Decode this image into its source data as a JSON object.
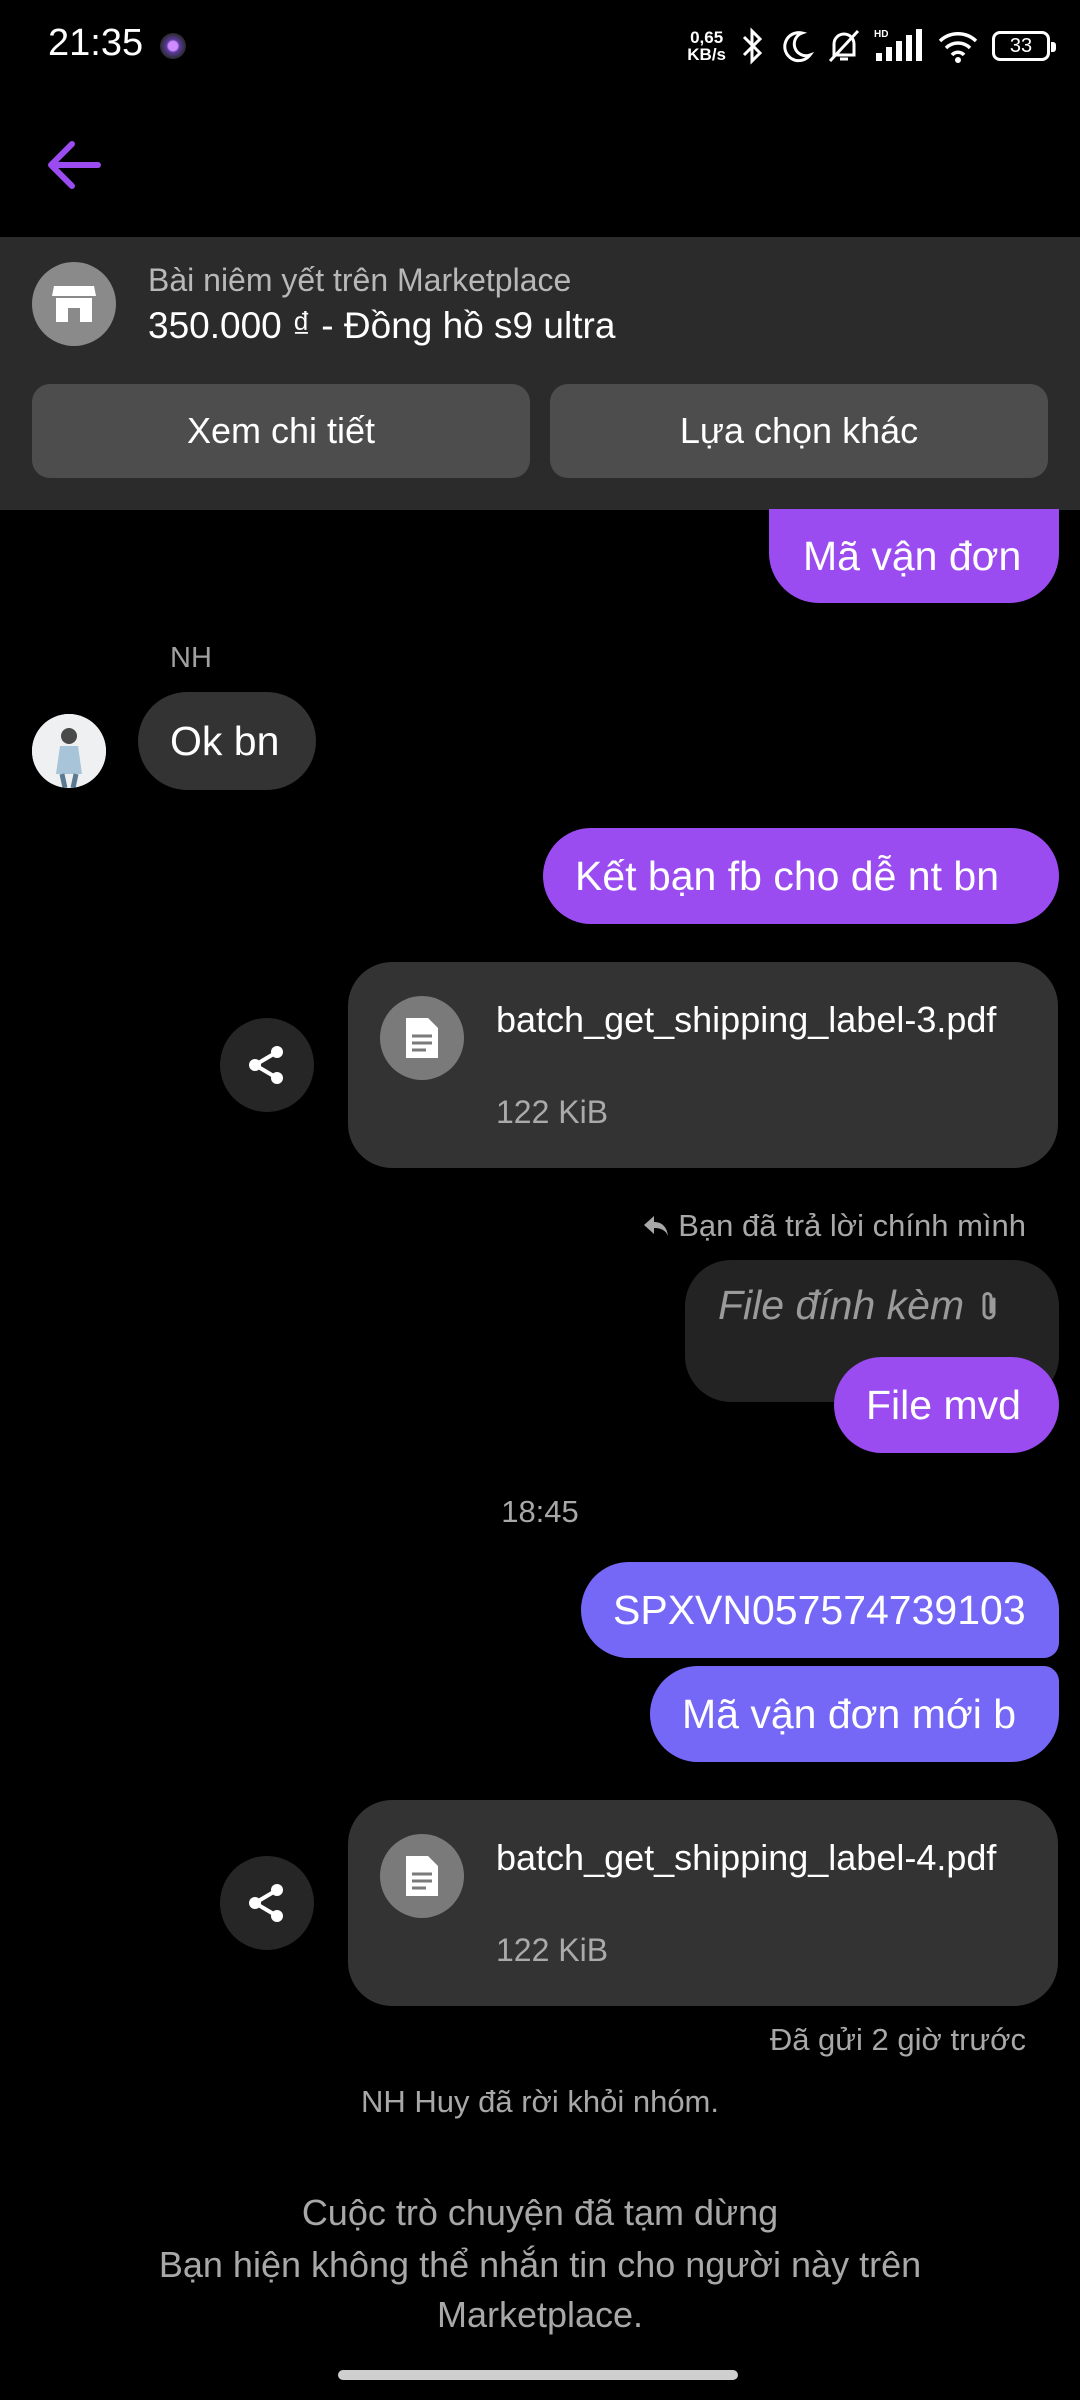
{
  "status_bar": {
    "time": "21:35",
    "net_speed_value": "0,65",
    "net_speed_unit": "KB/s",
    "battery": "33"
  },
  "marketplace": {
    "subtitle": "Bài niêm yết trên Marketplace",
    "title": "350.000 ₫ - Đồng hồ s9 ultra",
    "view_details": "Xem chi tiết",
    "other_options": "Lựa chọn khác"
  },
  "messages": {
    "m1": "Mã vận đơn",
    "sender_name": "NH",
    "m2": "Ok bn",
    "m3": "Kết bạn fb cho dễ nt bn",
    "file1_name": "batch_get_shipping_label-3.pdf",
    "file1_size": "122 KiB",
    "reply_note": "Bạn đã trả lời chính mình",
    "quoted": "File đính kèm",
    "m4": "File mvd",
    "time_sep": "18:45",
    "m5": "SPXVN057574739103",
    "m6": "Mã vận đơn mới b",
    "file2_name": "batch_get_shipping_label-4.pdf",
    "file2_size": "122 KiB",
    "sent_status": "Đã gửi 2 giờ trước",
    "system_note": "NH Huy đã rời khỏi nhóm.",
    "paused_title": "Cuộc trò chuyện đã tạm dừng",
    "paused_body": "Bạn hiện không thể nhắn tin cho người này trên Marketplace."
  },
  "colors": {
    "accent": "#9a4cf0",
    "bubble_violet": "#7668f6",
    "panel": "#2b2b2b"
  }
}
